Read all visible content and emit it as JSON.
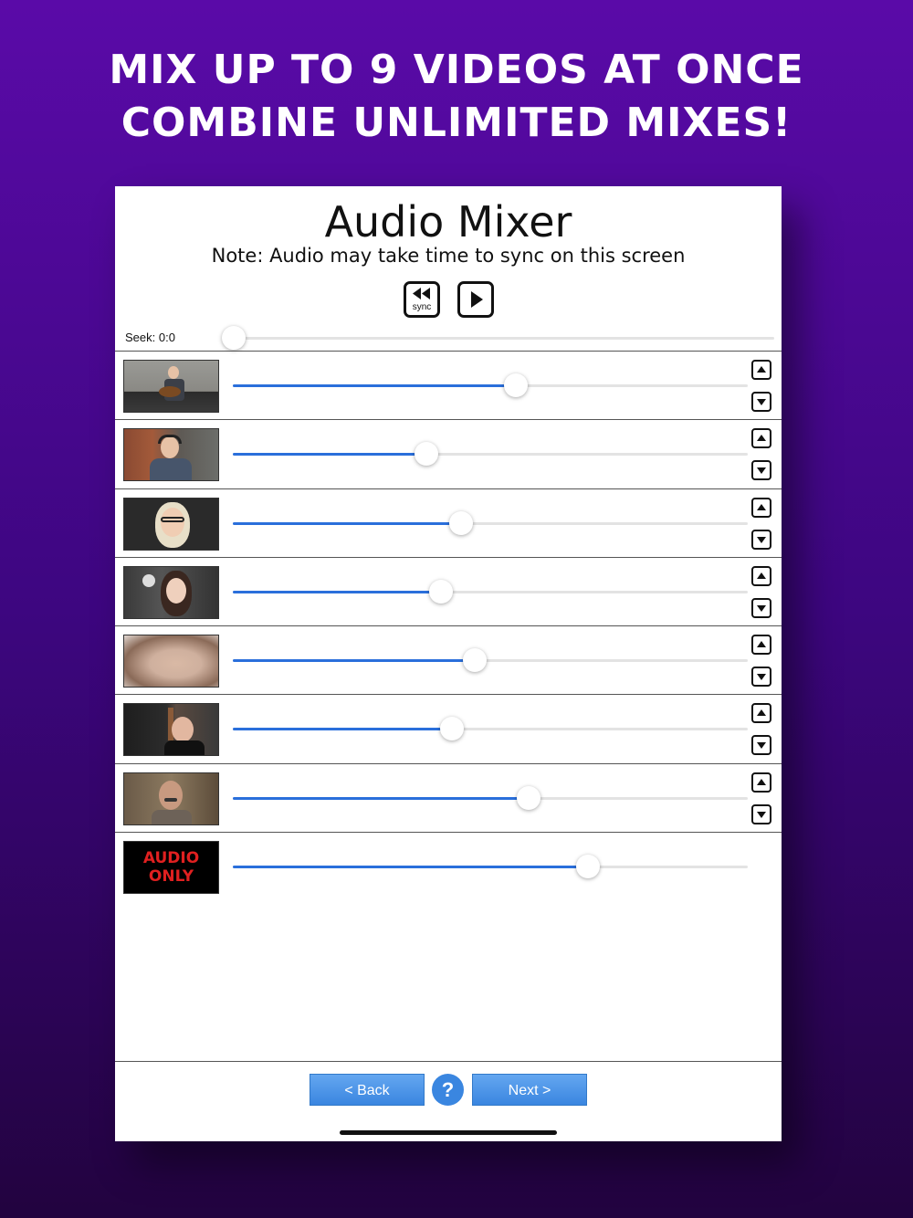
{
  "promo": {
    "line1": "MIX UP TO 9 VIDEOS AT ONCE",
    "line2": "COMBINE UNLIMITED MIXES!"
  },
  "screen": {
    "title": "Audio Mixer",
    "note": "Note: Audio may take time to sync on this screen"
  },
  "transport": {
    "sync_label": "sync",
    "rewind_icon": "rewind-sync-icon",
    "play_icon": "play-icon"
  },
  "seek": {
    "label": "Seek: 0:0",
    "value": 0
  },
  "tracks": [
    {
      "name": "track-1",
      "thumbnail": "guitar-player-video",
      "volume": 0.55,
      "reorder": true
    },
    {
      "name": "track-2",
      "thumbnail": "man-headphones-video",
      "volume": 0.376,
      "reorder": true
    },
    {
      "name": "track-3",
      "thumbnail": "woman-glasses-video",
      "volume": 0.443,
      "reorder": true
    },
    {
      "name": "track-4",
      "thumbnail": "woman-dark-hair-video",
      "volume": 0.405,
      "reorder": true
    },
    {
      "name": "track-5",
      "thumbnail": "blurry-face-video",
      "volume": 0.47,
      "reorder": true
    },
    {
      "name": "track-6",
      "thumbnail": "man-bookshelf-video",
      "volume": 0.425,
      "reorder": true
    },
    {
      "name": "track-7",
      "thumbnail": "man-mustache-video",
      "volume": 0.575,
      "reorder": true
    },
    {
      "name": "track-8",
      "thumbnail": "audio-only",
      "thumb_text_1": "AUDIO",
      "thumb_text_2": "ONLY",
      "volume": 0.69,
      "reorder": false
    }
  ],
  "footer": {
    "back_label": "< Back",
    "help_label": "?",
    "next_label": "Next >"
  },
  "colors": {
    "accent": "#2a6fdb",
    "button": "#3a86e0",
    "background_top": "#5a0aa8",
    "background_bottom": "#22033f"
  }
}
